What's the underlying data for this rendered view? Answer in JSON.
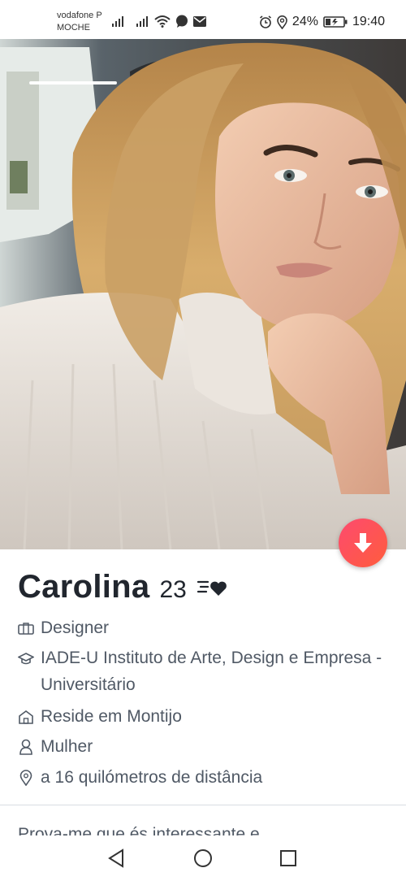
{
  "status_bar": {
    "carrier_line1": "vodafone P",
    "carrier_line2": "MOCHE",
    "battery": "24%",
    "time": "19:40"
  },
  "profile": {
    "name": "Carolina",
    "age": "23",
    "job": "Designer",
    "school": "IADE-U Instituto de Arte, Design e Empresa - Universitário",
    "residence": "Reside em Montijo",
    "gender": "Mulher",
    "distance": "a 16 quilómetros de distância",
    "bio_preview": "Prova-me que és interessante e"
  },
  "icons": {
    "job": "briefcase-icon",
    "school": "graduation-cap-icon",
    "residence": "house-icon",
    "gender": "person-icon",
    "distance": "location-pin-icon",
    "passport_heart": "heart-speed-icon",
    "fab": "arrow-down-icon"
  },
  "colors": {
    "accent_start": "#fd4a6f",
    "accent_end": "#ff5d3d",
    "name_text": "#21262e",
    "info_text": "#505965"
  }
}
